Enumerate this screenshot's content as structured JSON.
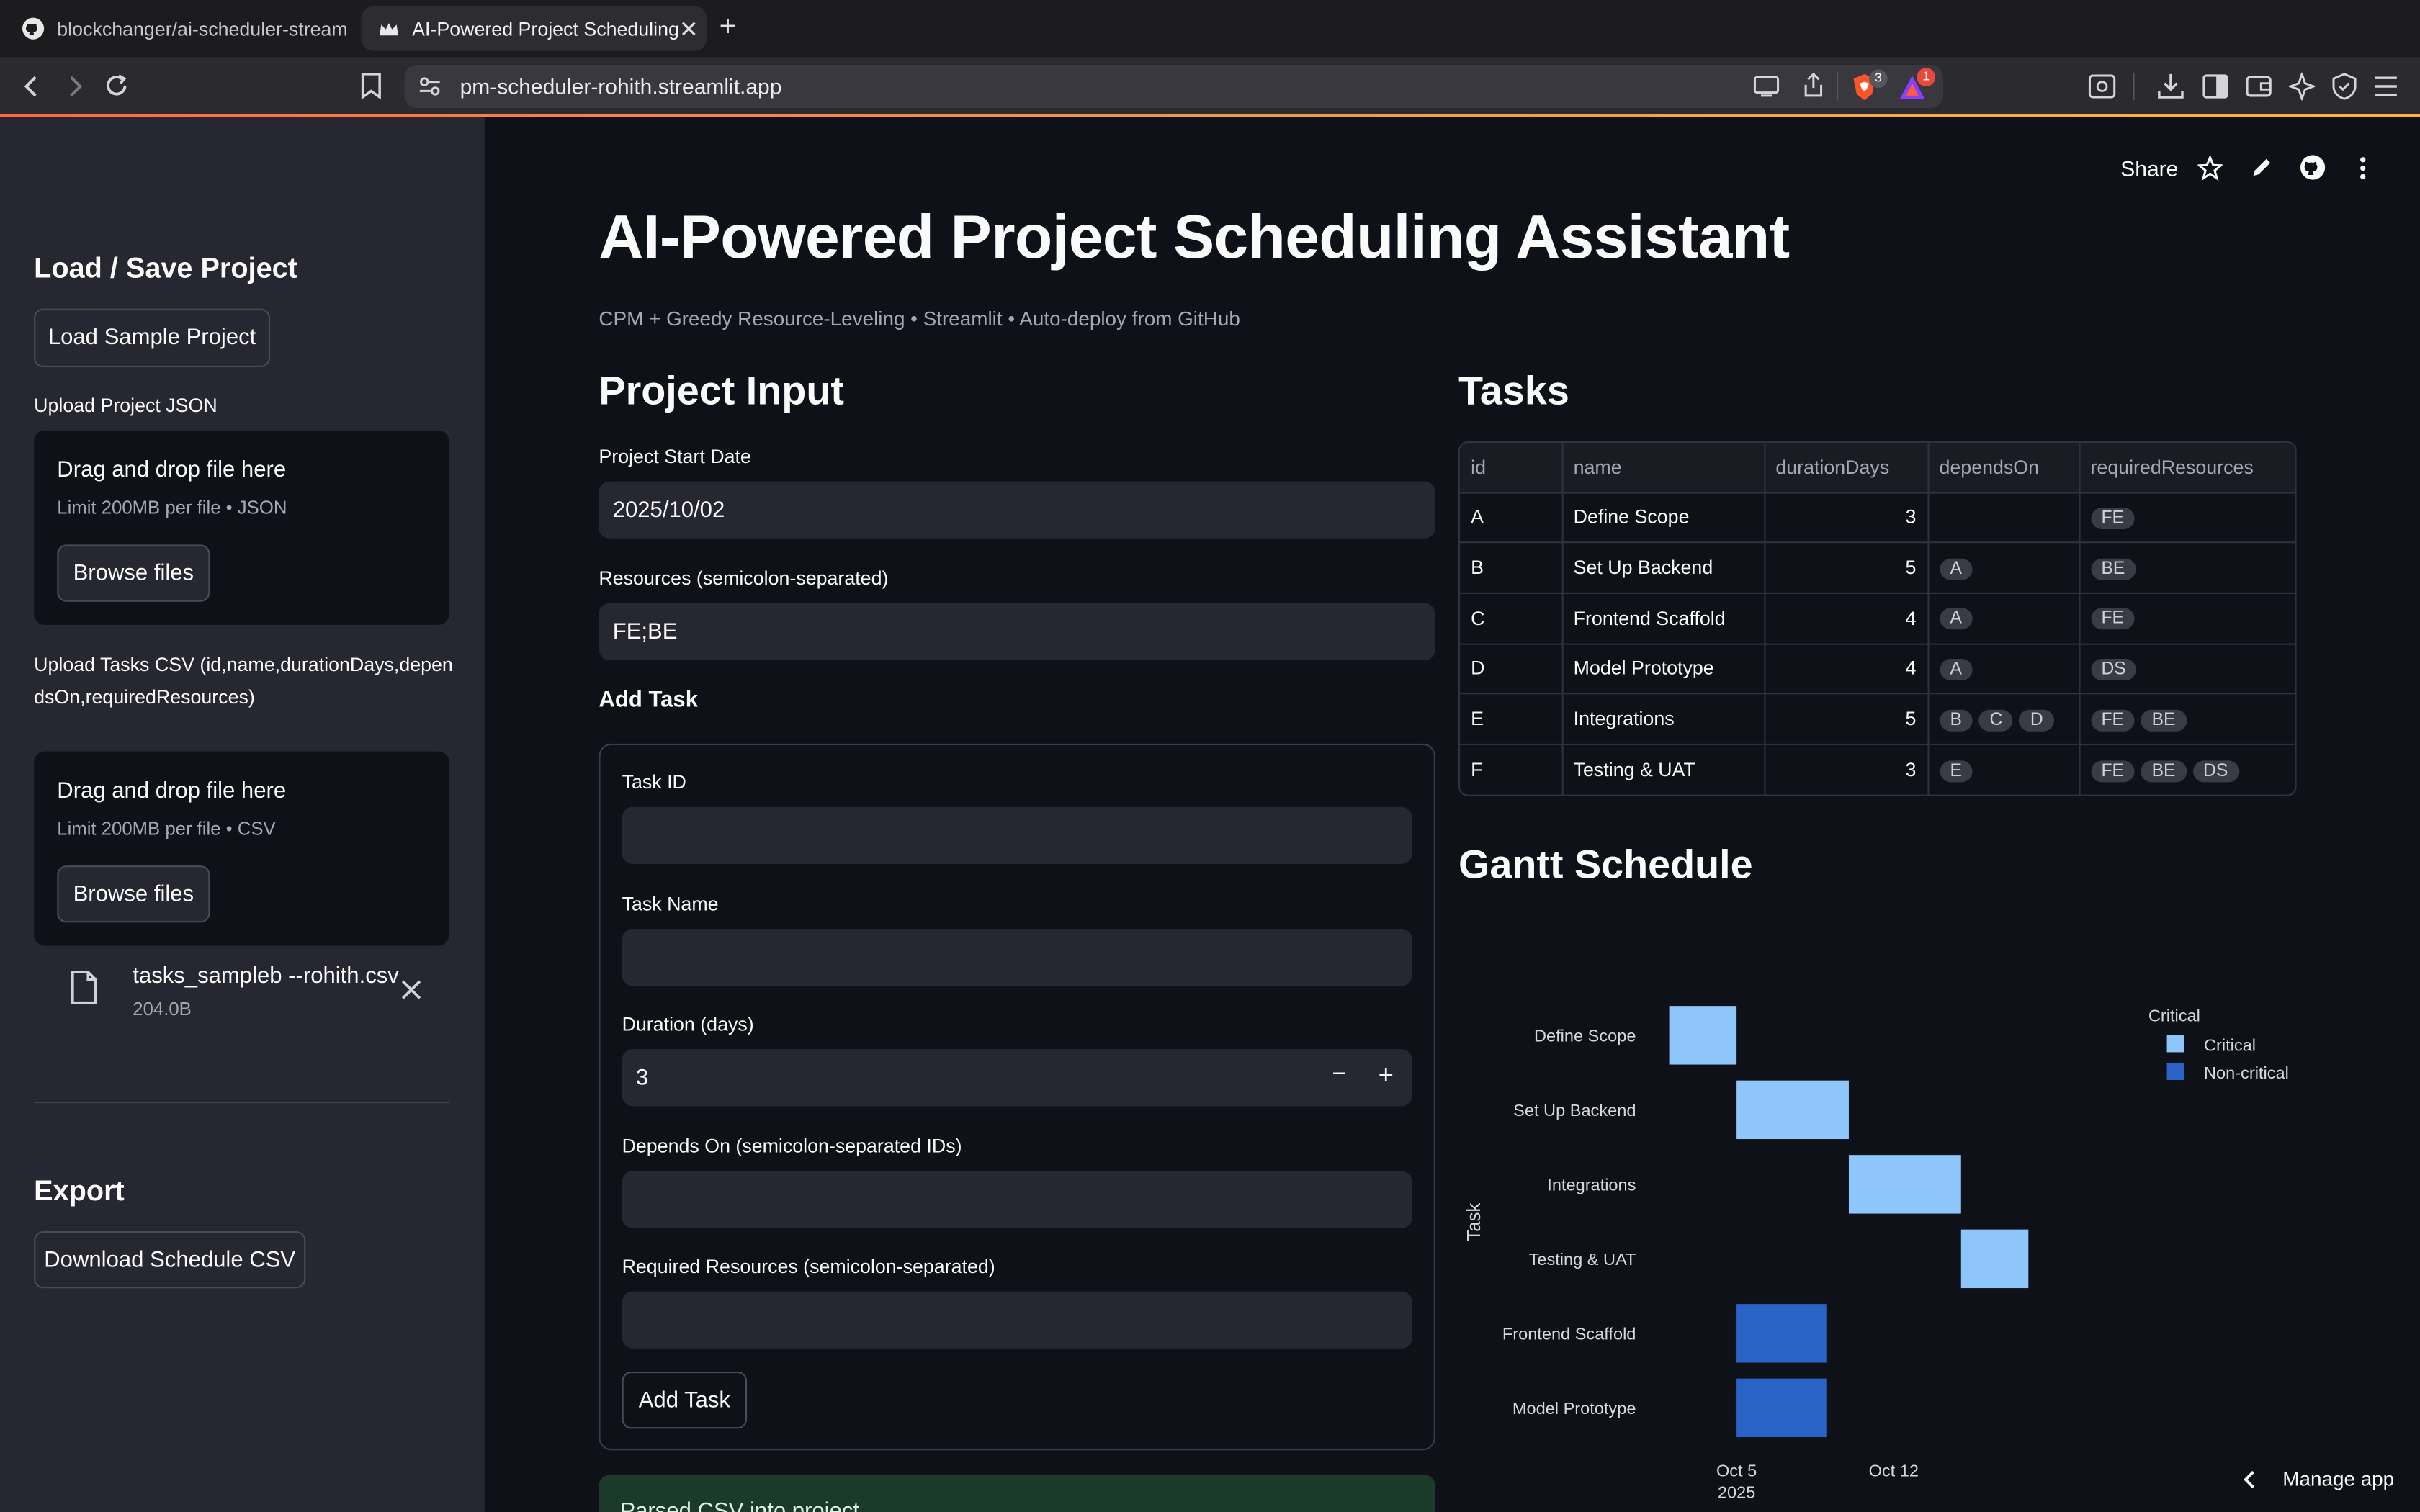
{
  "browser": {
    "tabs": [
      {
        "title": "blockchanger/ai-scheduler-stream",
        "active": false
      },
      {
        "title": "AI-Powered Project Scheduling",
        "active": true
      }
    ],
    "url": "pm-scheduler-rohith.streamlit.app",
    "shield_badge": "3",
    "alert_badge": "1"
  },
  "toolbar": {
    "share_label": "Share",
    "manage_app_label": "Manage app"
  },
  "sidebar": {
    "load_save_heading": "Load / Save Project",
    "load_sample_label": "Load Sample Project",
    "upload_json_label": "Upload Project JSON",
    "upload_json": {
      "drag_text": "Drag and drop file here",
      "limit_text": "Limit 200MB per file • JSON",
      "browse_label": "Browse files"
    },
    "upload_csv_label": "Upload Tasks CSV (id,name,durationDays,dependsOn,requiredResources)",
    "upload_csv": {
      "drag_text": "Drag and drop file here",
      "limit_text": "Limit 200MB per file • CSV",
      "browse_label": "Browse files"
    },
    "uploaded_file": {
      "name": "tasks_sampleb --rohith.csv",
      "size": "204.0B"
    },
    "export_heading": "Export",
    "download_label": "Download Schedule CSV"
  },
  "main": {
    "title": "AI-Powered Project Scheduling Assistant",
    "caption": "CPM + Greedy Resource-Leveling • Streamlit • Auto-deploy from GitHub",
    "project_input_heading": "Project Input",
    "start_date_label": "Project Start Date",
    "start_date_value": "2025/10/02",
    "resources_label": "Resources (semicolon-separated)",
    "resources_value": "FE;BE",
    "add_task_heading": "Add Task",
    "form": {
      "task_id_label": "Task ID",
      "task_name_label": "Task Name",
      "duration_label": "Duration (days)",
      "duration_value": "3",
      "depends_label": "Depends On (semicolon-separated IDs)",
      "resources_label": "Required Resources (semicolon-separated)",
      "submit_label": "Add Task"
    },
    "info_banner": "Parsed CSV into project",
    "tasks_heading": "Tasks",
    "gantt_heading": "Gantt Schedule"
  },
  "tasks_table": {
    "columns": [
      "id",
      "name",
      "durationDays",
      "dependsOn",
      "requiredResources"
    ],
    "rows": [
      {
        "id": "A",
        "name": "Define Scope",
        "durationDays": "3",
        "dependsOn": [],
        "requiredResources": [
          "FE"
        ]
      },
      {
        "id": "B",
        "name": "Set Up Backend",
        "durationDays": "5",
        "dependsOn": [
          "A"
        ],
        "requiredResources": [
          "BE"
        ]
      },
      {
        "id": "C",
        "name": "Frontend Scaffold",
        "durationDays": "4",
        "dependsOn": [
          "A"
        ],
        "requiredResources": [
          "FE"
        ]
      },
      {
        "id": "D",
        "name": "Model Prototype",
        "durationDays": "4",
        "dependsOn": [
          "A"
        ],
        "requiredResources": [
          "DS"
        ]
      },
      {
        "id": "E",
        "name": "Integrations",
        "durationDays": "5",
        "dependsOn": [
          "B",
          "C",
          "D"
        ],
        "requiredResources": [
          "FE",
          "BE"
        ]
      },
      {
        "id": "F",
        "name": "Testing & UAT",
        "durationDays": "3",
        "dependsOn": [
          "E"
        ],
        "requiredResources": [
          "FE",
          "BE",
          "DS"
        ]
      }
    ]
  },
  "chart_data": {
    "type": "bar",
    "orientation": "horizontal",
    "ylabel": "Task",
    "legend_title": "Critical",
    "legend_position": "top-right",
    "x_ticks": [
      {
        "date": "2025-10-05",
        "label": "Oct 5",
        "sublabel": "2025"
      },
      {
        "date": "2025-10-12",
        "label": "Oct 12",
        "sublabel": ""
      }
    ],
    "xlim": [
      "2025-10-01",
      "2025-10-23"
    ],
    "series": [
      {
        "name": "Critical",
        "color": "#8fc6fa"
      },
      {
        "name": "Non-critical",
        "color": "#2963c6"
      }
    ],
    "tasks": [
      {
        "name": "Define Scope",
        "start": "2025-10-02",
        "end": "2025-10-05",
        "series": "Critical"
      },
      {
        "name": "Set Up Backend",
        "start": "2025-10-05",
        "end": "2025-10-10",
        "series": "Critical"
      },
      {
        "name": "Integrations",
        "start": "2025-10-10",
        "end": "2025-10-15",
        "series": "Critical"
      },
      {
        "name": "Testing & UAT",
        "start": "2025-10-15",
        "end": "2025-10-18",
        "series": "Critical"
      },
      {
        "name": "Frontend Scaffold",
        "start": "2025-10-05",
        "end": "2025-10-09",
        "series": "Non-critical"
      },
      {
        "name": "Model Prototype",
        "start": "2025-10-05",
        "end": "2025-10-09",
        "series": "Non-critical"
      }
    ]
  }
}
